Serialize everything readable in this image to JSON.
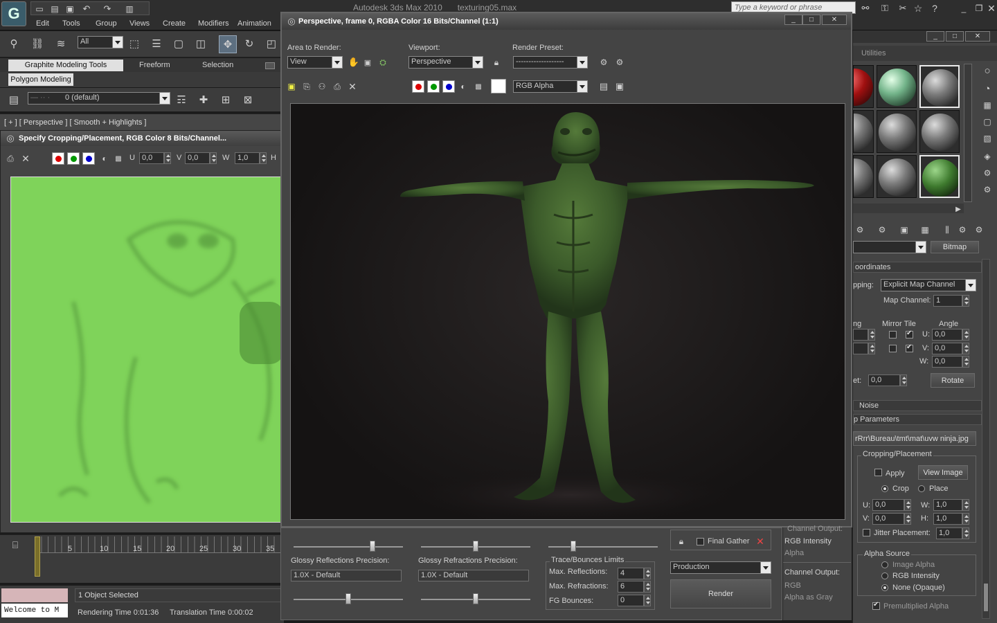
{
  "app": {
    "title": "Autodesk 3ds Max  2010",
    "file": "texturing05.max",
    "search_placeholder": "Type a keyword or phrase",
    "menu": [
      "Edit",
      "Tools",
      "Group",
      "Views",
      "Create",
      "Modifiers",
      "Animation"
    ]
  },
  "toolbar": {
    "selection_filter": "All",
    "ribbon_tabs": [
      "Graphite Modeling Tools",
      "Freeform",
      "Selection"
    ],
    "ribbon_sub": "Polygon Modeling",
    "layer": "0 (default)"
  },
  "viewport": {
    "label": "[ + ] [ Perspective ] [ Smooth + Highlights ]"
  },
  "crop_window": {
    "title": "Specify Cropping/Placement, RGB Color 8 Bits/Channel...",
    "u_label": "U",
    "u_value": "0,0",
    "v_label": "V",
    "v_value": "0,0",
    "w_label": "W",
    "w_value": "1,0",
    "h_label": "H"
  },
  "timeline": {
    "ticks": [
      "0",
      "5",
      "10",
      "15",
      "20",
      "25",
      "30",
      "35"
    ]
  },
  "status": {
    "welcome": "Welcome to M",
    "selected": "1 Object Selected",
    "render_time": "Rendering Time  0:01:36",
    "translation_time": "Translation Time  0:00:02"
  },
  "render_window": {
    "title": "Perspective, frame 0, RGBA Color 16 Bits/Channel (1:1)",
    "area_label": "Area to Render:",
    "area_value": "View",
    "viewport_label": "Viewport:",
    "viewport_value": "Perspective",
    "preset_label": "Render Preset:",
    "preset_value": "-------------------",
    "channel_value": "RGB Alpha"
  },
  "render_setup": {
    "glossy_reflections_label": "Glossy Reflections Precision:",
    "glossy_reflections_value": "1.0X - Default",
    "glossy_refractions_label": "Glossy Refractions Precision:",
    "glossy_refractions_value": "1.0X - Default",
    "trace_group": "Trace/Bounces Limits",
    "max_reflections_label": "Max. Reflections:",
    "max_reflections": "4",
    "max_refractions_label": "Max. Refractions:",
    "max_refractions": "6",
    "fg_bounces_label": "FG Bounces:",
    "fg_bounces": "0",
    "final_gather": "Final Gather",
    "production": "Production",
    "render_button": "Render"
  },
  "material_editor": {
    "utilities": "Utilities",
    "bitmap": "Bitmap",
    "coordinates": "oordinates",
    "mapping_label": "pping:",
    "mapping_value": "Explicit Map Channel",
    "map_channel_label": "Map Channel:",
    "map_channel": "1",
    "tiling_label": "ng",
    "mirror_tile": "Mirror Tile",
    "angle": "Angle",
    "u_label": "U:",
    "u_angle": "0,0",
    "v_label": "V:",
    "v_angle": "0,0",
    "w_label": "W:",
    "w_angle": "0,0",
    "blur_offset_label": "et:",
    "blur_offset": "0,0",
    "rotate": "Rotate",
    "noise": "Noise",
    "bitmap_params": "p Parameters",
    "bitmap_path": "rRrr\\Bureau\\tmt\\mat\\uvw ninja.jpg",
    "cropping_group": "Cropping/Placement",
    "apply": "Apply",
    "view_image": "View Image",
    "crop": "Crop",
    "place": "Place",
    "crop_u_label": "U:",
    "crop_u": "0,0",
    "crop_w_label": "W:",
    "crop_w": "1,0",
    "crop_v_label": "V:",
    "crop_v": "0,0",
    "crop_h_label": "H:",
    "crop_h": "1,0",
    "jitter": "Jitter Placement:",
    "jitter_value": "1,0",
    "channel_output_top": "Channel Output:",
    "rgb_intensity": "RGB Intensity",
    "alpha": "Alpha",
    "channel_output": "Channel Output:",
    "rgb": "RGB",
    "alpha_as_gray": "Alpha as Gray",
    "alpha_source_group": "Alpha Source",
    "image_alpha": "Image Alpha",
    "rgb_intensity_2": "RGB Intensity",
    "none_opaque": "None (Opaque)",
    "premultiplied": "Premultiplied Alpha"
  },
  "colors": {
    "uv_green": "#7fd35a",
    "render_bg": "#171515",
    "figure": "#3d5a2c"
  }
}
